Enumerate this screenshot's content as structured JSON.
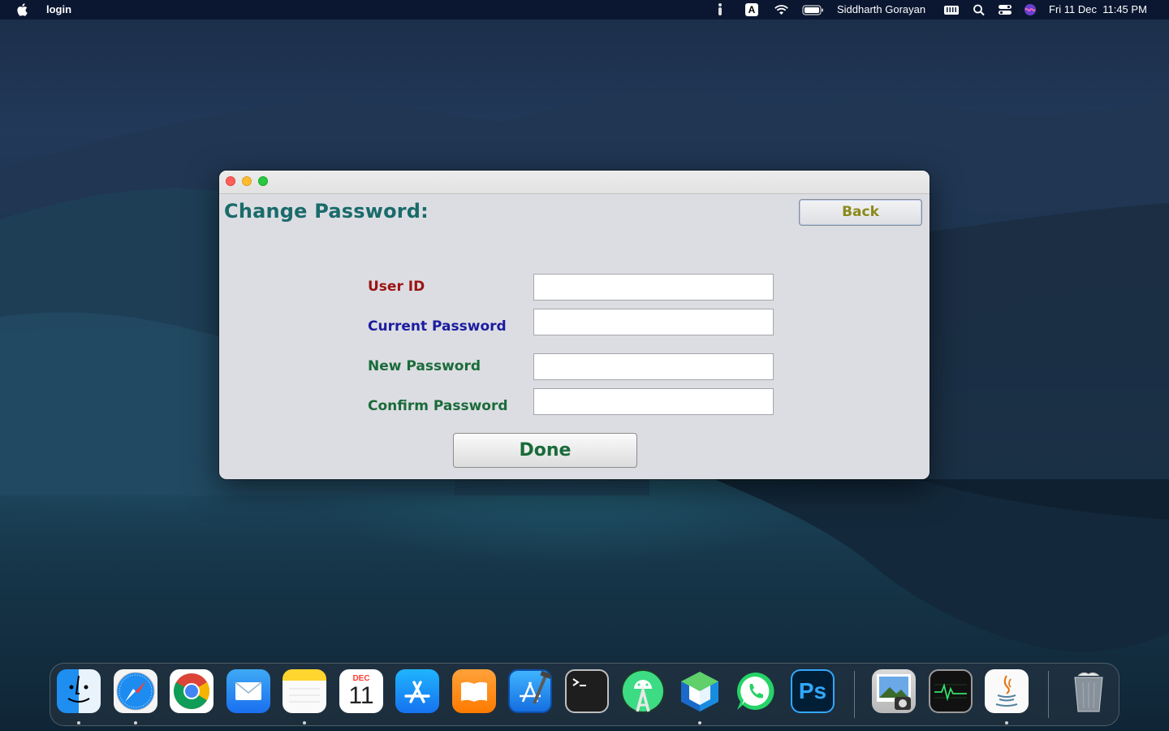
{
  "menubar": {
    "app_name": "login",
    "user_name": "Siddharth Gorayan",
    "datetime": "Fri 11 Dec  11:45 PM",
    "input_source": "A",
    "icons": [
      "apple-icon",
      "accessibility-icon",
      "input-source-icon",
      "wifi-icon",
      "battery-icon",
      "keyboard-viewer-icon",
      "spotlight-icon",
      "control-center-icon",
      "siri-icon"
    ]
  },
  "window": {
    "title": "Change Password:",
    "back_label": "Back",
    "done_label": "Done",
    "fields": [
      {
        "label": "User ID",
        "value": "",
        "color": "#9b1414"
      },
      {
        "label": "Current Password",
        "value": "",
        "color": "#1c1ca0"
      },
      {
        "label": "New Password",
        "value": "",
        "color": "#1a6b3a"
      },
      {
        "label": "Confirm Password",
        "value": "",
        "color": "#1a6b3a"
      }
    ],
    "colors": {
      "title": "#1a6b6b",
      "back": "#8a8a1a",
      "done": "#1a6b3a"
    }
  },
  "dock": {
    "calendar_month": "DEC",
    "calendar_day": "11",
    "photoshop_label": "Ps",
    "apps": [
      "Finder",
      "Safari",
      "Google Chrome",
      "Mail",
      "Notes",
      "Calendar",
      "App Store",
      "Books",
      "Xcode",
      "Terminal",
      "Android Studio",
      "NetBeans",
      "WhatsApp",
      "Photoshop",
      "Preview",
      "Activity Monitor",
      "Java",
      "Trash"
    ]
  }
}
